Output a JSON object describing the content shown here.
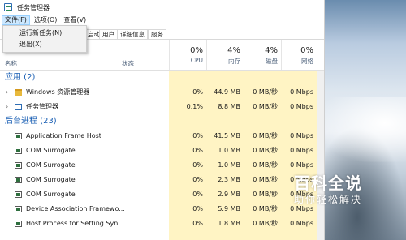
{
  "window": {
    "title": "任务管理器",
    "menu": [
      {
        "label": "文件(F)",
        "active": true
      },
      {
        "label": "选项(O)",
        "active": false
      },
      {
        "label": "查看(V)",
        "active": false
      }
    ],
    "file_menu": [
      "运行新任务(N)",
      "退出(X)"
    ],
    "tabs": [
      "启动",
      "用户",
      "详细信息",
      "服务"
    ]
  },
  "columns": {
    "name": "名称",
    "status": "状态",
    "cpu": {
      "pct": "0%",
      "label": "CPU"
    },
    "memory": {
      "pct": "4%",
      "label": "内存"
    },
    "disk": {
      "pct": "4%",
      "label": "磁盘"
    },
    "network": {
      "pct": "0%",
      "label": "网络"
    }
  },
  "groups": {
    "apps": {
      "label": "应用 (2)",
      "rows": [
        {
          "name": "Windows 资源管理器",
          "cpu": "0%",
          "memory": "44.9 MB",
          "disk": "0 MB/秒",
          "network": "0 Mbps",
          "icon": "folder-icon"
        },
        {
          "name": "任务管理器",
          "cpu": "0.1%",
          "memory": "8.8 MB",
          "disk": "0 MB/秒",
          "network": "0 Mbps",
          "icon": "task-manager-icon"
        }
      ]
    },
    "background": {
      "label": "后台进程 (23)",
      "rows": [
        {
          "name": "Application Frame Host",
          "cpu": "0%",
          "memory": "41.5 MB",
          "disk": "0 MB/秒",
          "network": "0 Mbps"
        },
        {
          "name": "COM Surrogate",
          "cpu": "0%",
          "memory": "1.0 MB",
          "disk": "0 MB/秒",
          "network": "0 Mbps"
        },
        {
          "name": "COM Surrogate",
          "cpu": "0%",
          "memory": "1.0 MB",
          "disk": "0 MB/秒",
          "network": "0 Mbps"
        },
        {
          "name": "COM Surrogate",
          "cpu": "0%",
          "memory": "2.3 MB",
          "disk": "0 MB/秒",
          "network": "0 Mbps"
        },
        {
          "name": "COM Surrogate",
          "cpu": "0%",
          "memory": "2.9 MB",
          "disk": "0 MB/秒",
          "network": "0 Mbps"
        },
        {
          "name": "Device Association Framewo...",
          "cpu": "0%",
          "memory": "5.9 MB",
          "disk": "0 MB/秒",
          "network": "0 Mbps"
        },
        {
          "name": "Host Process for Setting Syn...",
          "cpu": "0%",
          "memory": "1.8 MB",
          "disk": "0 MB/秒",
          "network": "0 Mbps"
        }
      ]
    }
  },
  "watermark": {
    "main": "百科全说",
    "sub": "助你轻松解决"
  },
  "colors": {
    "highlight": "#fff4c4",
    "group_text": "#1a5fb4"
  }
}
